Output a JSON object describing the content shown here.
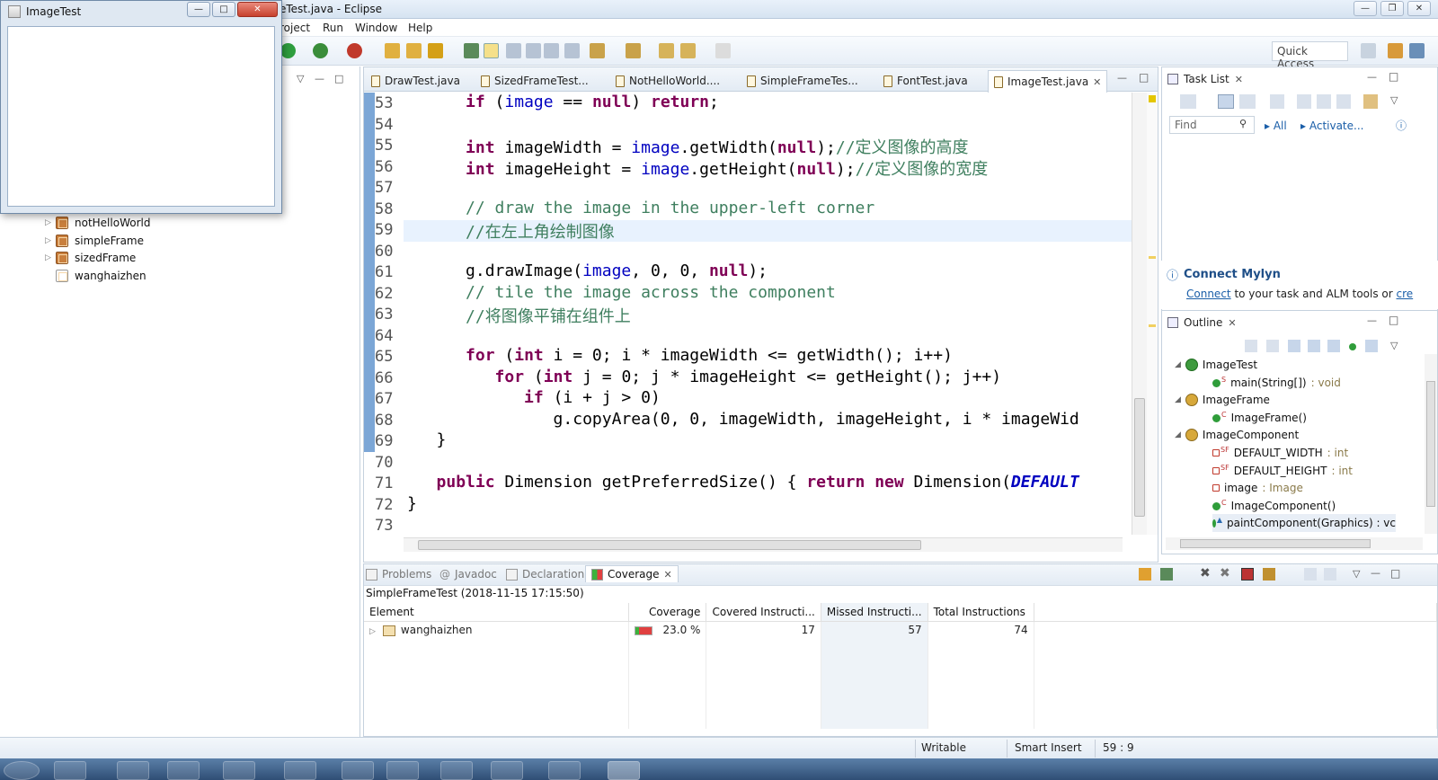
{
  "window": {
    "title": "ImageTest.java - Eclipse",
    "title_partial": "eTest.java - Eclipse"
  },
  "menu": [
    {
      "label": "roject"
    },
    {
      "label": "Run"
    },
    {
      "label": "Window"
    },
    {
      "label": "Help"
    }
  ],
  "toolbar": {
    "quick_access": "Quick Access"
  },
  "image_window": {
    "title": "ImageTest"
  },
  "explorer": {
    "items": [
      {
        "label": "notHelloWorld",
        "type": "package"
      },
      {
        "label": "simpleFrame",
        "type": "package"
      },
      {
        "label": "sizedFrame",
        "type": "package"
      },
      {
        "label": "wanghaizhen",
        "type": "empty-package"
      }
    ]
  },
  "editor": {
    "tabs": [
      {
        "label": "DrawTest.java"
      },
      {
        "label": "SizedFrameTest..."
      },
      {
        "label": "NotHelloWorld...."
      },
      {
        "label": "SimpleFrameTes..."
      },
      {
        "label": "FontTest.java"
      },
      {
        "label": "ImageTest.java",
        "active": true
      }
    ],
    "lines": [
      {
        "n": "53",
        "tokens": [
          [
            "",
            "      "
          ],
          [
            "kw",
            "if"
          ],
          [
            "",
            " ("
          ],
          [
            "fld",
            "image"
          ],
          [
            "",
            " == "
          ],
          [
            "kw",
            "null"
          ],
          [
            "",
            ") "
          ],
          [
            "kw",
            "return"
          ],
          [
            "",
            ";"
          ]
        ]
      },
      {
        "n": "54",
        "tokens": []
      },
      {
        "n": "55",
        "tokens": [
          [
            "",
            "      "
          ],
          [
            "kw",
            "int"
          ],
          [
            "",
            " imageWidth = "
          ],
          [
            "fld",
            "image"
          ],
          [
            "",
            ".getWidth("
          ],
          [
            "kw",
            "null"
          ],
          [
            "",
            ");"
          ],
          [
            "cm",
            "//定义图像的高度"
          ]
        ]
      },
      {
        "n": "56",
        "tokens": [
          [
            "",
            "      "
          ],
          [
            "kw",
            "int"
          ],
          [
            "",
            " imageHeight = "
          ],
          [
            "fld",
            "image"
          ],
          [
            "",
            ".getHeight("
          ],
          [
            "kw",
            "null"
          ],
          [
            "",
            ");"
          ],
          [
            "cm",
            "//定义图像的宽度"
          ]
        ]
      },
      {
        "n": "57",
        "tokens": []
      },
      {
        "n": "58",
        "tokens": [
          [
            "",
            "      "
          ],
          [
            "cm",
            "// draw the image in the upper-left corner"
          ]
        ]
      },
      {
        "n": "59",
        "tokens": [
          [
            "",
            "      "
          ],
          [
            "cm",
            "//在左上角绘制图像"
          ]
        ]
      },
      {
        "n": "60",
        "tokens": []
      },
      {
        "n": "61",
        "tokens": [
          [
            "",
            "      g.drawImage("
          ],
          [
            "fld",
            "image"
          ],
          [
            "",
            ", 0, 0, "
          ],
          [
            "kw",
            "null"
          ],
          [
            "",
            ");"
          ]
        ]
      },
      {
        "n": "62",
        "tokens": [
          [
            "",
            "      "
          ],
          [
            "cm",
            "// tile the image across the component"
          ]
        ]
      },
      {
        "n": "63",
        "tokens": [
          [
            "",
            "      "
          ],
          [
            "cm",
            "//将图像平铺在组件上"
          ]
        ]
      },
      {
        "n": "64",
        "tokens": []
      },
      {
        "n": "65",
        "tokens": [
          [
            "",
            "      "
          ],
          [
            "kw",
            "for"
          ],
          [
            "",
            " ("
          ],
          [
            "kw",
            "int"
          ],
          [
            "",
            " i = 0; i * imageWidth <= getWidth(); i++)"
          ]
        ]
      },
      {
        "n": "66",
        "tokens": [
          [
            "",
            "         "
          ],
          [
            "kw",
            "for"
          ],
          [
            "",
            " ("
          ],
          [
            "kw",
            "int"
          ],
          [
            "",
            " j = 0; j * imageHeight <= getHeight(); j++)"
          ]
        ]
      },
      {
        "n": "67",
        "tokens": [
          [
            "",
            "            "
          ],
          [
            "kw",
            "if"
          ],
          [
            "",
            " (i + j > 0)"
          ]
        ]
      },
      {
        "n": "68",
        "tokens": [
          [
            "",
            "               g.copyArea(0, 0, imageWidth, imageHeight, i * imageWid"
          ]
        ]
      },
      {
        "n": "69",
        "tokens": [
          [
            "",
            "   }"
          ]
        ]
      },
      {
        "n": "70",
        "tokens": []
      },
      {
        "n": "71",
        "tokens": [
          [
            "",
            "   "
          ],
          [
            "kw",
            "public"
          ],
          [
            "",
            " Dimension getPreferredSize() { "
          ],
          [
            "kw",
            "return"
          ],
          [
            "",
            " "
          ],
          [
            "kw",
            "new"
          ],
          [
            "",
            " Dimension("
          ],
          [
            "it",
            "DEFAULT"
          ]
        ]
      },
      {
        "n": "72",
        "tokens": [
          [
            "",
            "}"
          ]
        ]
      },
      {
        "n": "73",
        "tokens": []
      }
    ]
  },
  "tasklist": {
    "title": "Task List",
    "find_placeholder": "Find",
    "all": "All",
    "activate": "Activate...",
    "mylyn_title": "Connect Mylyn",
    "mylyn_link": "Connect",
    "mylyn_text": " to your task and ALM tools or ",
    "mylyn_more": "cre"
  },
  "outline": {
    "title": "Outline",
    "items": [
      {
        "label": "ImageTest",
        "type": "",
        "depth": 0
      },
      {
        "label": "main(String[])",
        "type": " : void",
        "depth": 1
      },
      {
        "label": "ImageFrame",
        "type": "",
        "depth": 0
      },
      {
        "label": "ImageFrame()",
        "type": "",
        "depth": 1
      },
      {
        "label": "ImageComponent",
        "type": "",
        "depth": 0
      },
      {
        "label": "DEFAULT_WIDTH",
        "type": " : int",
        "depth": 1
      },
      {
        "label": "DEFAULT_HEIGHT",
        "type": " : int",
        "depth": 1
      },
      {
        "label": "image",
        "type": " : Image",
        "depth": 1
      },
      {
        "label": "ImageComponent()",
        "type": "",
        "depth": 1
      },
      {
        "label": "paintComponent(Graphics) : vc",
        "type": "",
        "depth": 1
      }
    ]
  },
  "bottom": {
    "tabs": [
      {
        "label": "Problems"
      },
      {
        "label": "Javadoc"
      },
      {
        "label": "Declaration"
      },
      {
        "label": "Coverage",
        "active": true
      }
    ],
    "session": "SimpleFrameTest (2018-11-15 17:15:50)",
    "columns": [
      "Element",
      "Coverage",
      "Covered Instructi...",
      "Missed Instructi...",
      "Total Instructions"
    ],
    "rows": [
      {
        "element": "wanghaizhen",
        "coverage": "23.0 %",
        "coverage_fraction": 0.23,
        "covered": "17",
        "missed": "57",
        "total": "74"
      }
    ]
  },
  "status": {
    "writable": "Writable",
    "insert": "Smart Insert",
    "position": "59 : 9"
  }
}
